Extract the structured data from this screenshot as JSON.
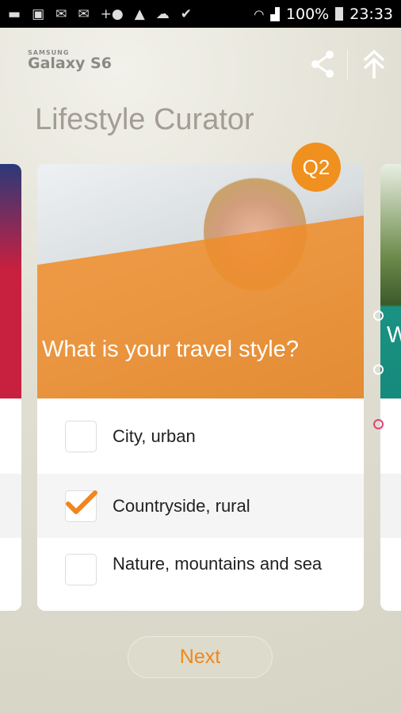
{
  "status_bar": {
    "battery": "100%",
    "time": "23:33",
    "icons": [
      "chat-icon",
      "gallery-icon",
      "email-icon",
      "mail-icon",
      "add-contact-icon",
      "warning-icon",
      "cloud-upload-icon",
      "check-icon",
      "wifi-icon",
      "signal-icon",
      "battery-icon"
    ]
  },
  "brand": {
    "maker": "SAMSUNG",
    "model": "Galaxy S6"
  },
  "header": {
    "title": "Lifestyle Curator"
  },
  "card": {
    "badge": "Q2",
    "question": "What is your travel style?",
    "accent": "#f0901e",
    "options": [
      {
        "label": "City, urban",
        "checked": false
      },
      {
        "label": "Countryside, rural",
        "checked": true
      },
      {
        "label": "Nature, mountains and sea",
        "checked": false
      }
    ]
  },
  "next_card": {
    "question_initial": "W"
  },
  "pager": {
    "total": 3,
    "active": 3
  },
  "next_button": {
    "label": "Next"
  }
}
